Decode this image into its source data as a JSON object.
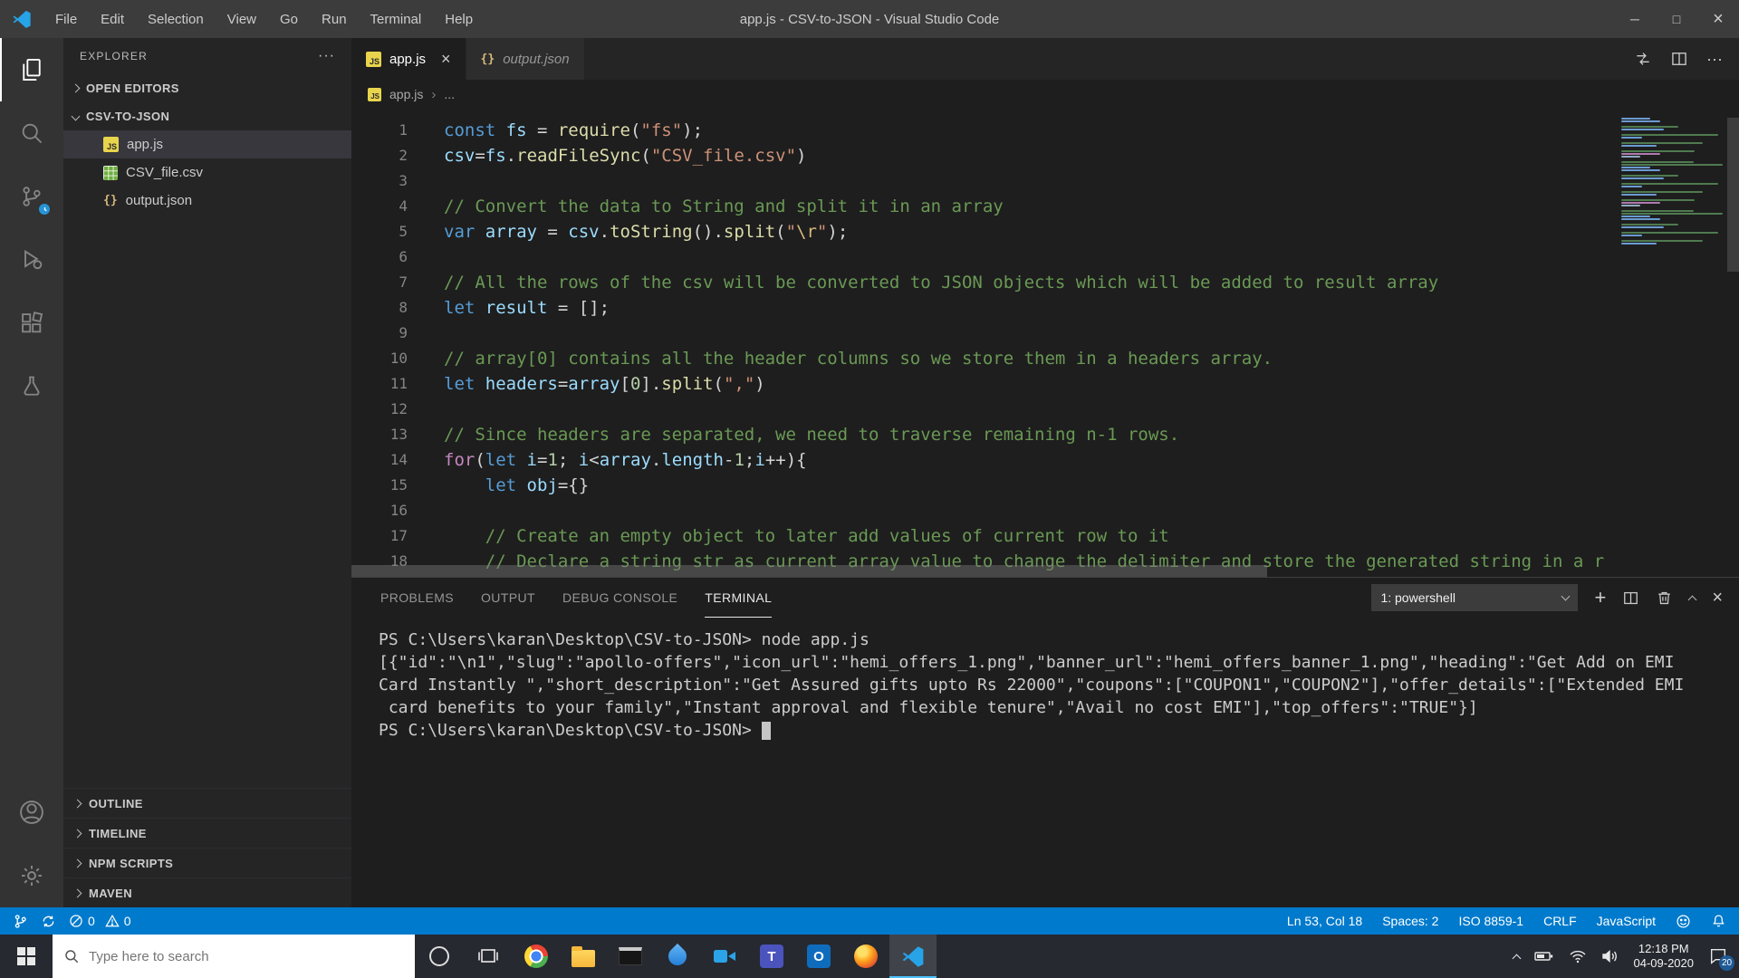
{
  "window": {
    "title": "app.js - CSV-to-JSON - Visual Studio Code",
    "menus": [
      "File",
      "Edit",
      "Selection",
      "View",
      "Go",
      "Run",
      "Terminal",
      "Help"
    ]
  },
  "icons": {
    "minimize": "─",
    "maximize": "□",
    "close": "×",
    "more_horizontal": "···",
    "breadcrumb_chevron": "›",
    "plus": "+",
    "js_glyph": "JS",
    "json_glyph": "{}",
    "teams_glyph": "T",
    "outlook_glyph": "O"
  },
  "activity_bar": {
    "items": [
      "explorer",
      "search",
      "source-control",
      "run-debug",
      "extensions",
      "test",
      "accounts",
      "settings"
    ]
  },
  "sidebar": {
    "title": "EXPLORER",
    "open_editors_label": "OPEN EDITORS",
    "folder_label": "CSV-TO-JSON",
    "files": [
      {
        "name": "app.js",
        "icon": "js",
        "selected": true
      },
      {
        "name": "CSV_file.csv",
        "icon": "csv",
        "selected": false
      },
      {
        "name": "output.json",
        "icon": "json",
        "selected": false
      }
    ],
    "bottom_sections": [
      "OUTLINE",
      "TIMELINE",
      "NPM SCRIPTS",
      "MAVEN"
    ]
  },
  "editor_tabs": [
    {
      "label": "app.js",
      "icon": "js",
      "active": true,
      "preview": false
    },
    {
      "label": "output.json",
      "icon": "json",
      "active": false,
      "preview": true
    }
  ],
  "breadcrumb": {
    "file": "app.js",
    "more": "..."
  },
  "editor": {
    "lines": [
      {
        "n": 1,
        "tokens": [
          [
            "kw",
            "const "
          ],
          [
            "var",
            "fs"
          ],
          [
            "pun",
            " = "
          ],
          [
            "fn",
            "require"
          ],
          [
            "pun",
            "("
          ],
          [
            "str",
            "\"fs\""
          ],
          [
            "pun",
            ");"
          ]
        ]
      },
      {
        "n": 2,
        "tokens": [
          [
            "var",
            "csv"
          ],
          [
            "pun",
            "="
          ],
          [
            "var",
            "fs"
          ],
          [
            "pun",
            "."
          ],
          [
            "fn",
            "readFileSync"
          ],
          [
            "pun",
            "("
          ],
          [
            "str",
            "\"CSV_file.csv\""
          ],
          [
            "pun",
            ")"
          ]
        ]
      },
      {
        "n": 3,
        "tokens": []
      },
      {
        "n": 4,
        "tokens": [
          [
            "com",
            "// Convert the data to String and split it in an array"
          ]
        ]
      },
      {
        "n": 5,
        "tokens": [
          [
            "kw",
            "var "
          ],
          [
            "var",
            "array"
          ],
          [
            "pun",
            " = "
          ],
          [
            "var",
            "csv"
          ],
          [
            "pun",
            "."
          ],
          [
            "fn",
            "toString"
          ],
          [
            "pun",
            "()."
          ],
          [
            "fn",
            "split"
          ],
          [
            "pun",
            "("
          ],
          [
            "str",
            "\""
          ],
          [
            "esc",
            "\\r"
          ],
          [
            "str",
            "\""
          ],
          [
            "pun",
            ");"
          ]
        ]
      },
      {
        "n": 6,
        "tokens": []
      },
      {
        "n": 7,
        "tokens": [
          [
            "com",
            "// All the rows of the csv will be converted to JSON objects which will be added to result array"
          ]
        ]
      },
      {
        "n": 8,
        "tokens": [
          [
            "kw",
            "let "
          ],
          [
            "var",
            "result"
          ],
          [
            "pun",
            " = [];"
          ]
        ]
      },
      {
        "n": 9,
        "tokens": []
      },
      {
        "n": 10,
        "tokens": [
          [
            "com",
            "// array[0] contains all the header columns so we store them in a headers array."
          ]
        ]
      },
      {
        "n": 11,
        "tokens": [
          [
            "kw",
            "let "
          ],
          [
            "var",
            "headers"
          ],
          [
            "pun",
            "="
          ],
          [
            "var",
            "array"
          ],
          [
            "pun",
            "["
          ],
          [
            "num",
            "0"
          ],
          [
            "pun",
            "]."
          ],
          [
            "fn",
            "split"
          ],
          [
            "pun",
            "("
          ],
          [
            "str",
            "\",\""
          ],
          [
            "pun",
            ")"
          ]
        ]
      },
      {
        "n": 12,
        "tokens": []
      },
      {
        "n": 13,
        "tokens": [
          [
            "com",
            "// Since headers are separated, we need to traverse remaining n-1 rows."
          ]
        ]
      },
      {
        "n": 14,
        "tokens": [
          [
            "ctrl",
            "for"
          ],
          [
            "pun",
            "("
          ],
          [
            "kw",
            "let "
          ],
          [
            "var",
            "i"
          ],
          [
            "pun",
            "="
          ],
          [
            "num",
            "1"
          ],
          [
            "pun",
            "; "
          ],
          [
            "var",
            "i"
          ],
          [
            "pun",
            "<"
          ],
          [
            "var",
            "array"
          ],
          [
            "pun",
            "."
          ],
          [
            "var",
            "length"
          ],
          [
            "pun",
            "-"
          ],
          [
            "num",
            "1"
          ],
          [
            "pun",
            ";"
          ],
          [
            "var",
            "i"
          ],
          [
            "pun",
            "++){"
          ]
        ]
      },
      {
        "n": 15,
        "tokens": [
          [
            "pun",
            "    "
          ],
          [
            "kw",
            "let "
          ],
          [
            "var",
            "obj"
          ],
          [
            "pun",
            "={}"
          ]
        ]
      },
      {
        "n": 16,
        "tokens": []
      },
      {
        "n": 17,
        "tokens": [
          [
            "com",
            "    // Create an empty object to later add values of current row to it"
          ]
        ]
      },
      {
        "n": 18,
        "tokens": [
          [
            "com",
            "    // Declare a string str as current array value to change the delimiter and store the generated string in a r"
          ]
        ]
      }
    ]
  },
  "panel": {
    "tabs": [
      "PROBLEMS",
      "OUTPUT",
      "DEBUG CONSOLE",
      "TERMINAL"
    ],
    "active_tab": "TERMINAL",
    "shell_selector": "1: powershell",
    "terminal_lines": [
      {
        "text": "PS C:\\Users\\karan\\Desktop\\CSV-to-JSON> node app.js",
        "cursor": false
      },
      {
        "text": "[{\"id\":\"\\n1\",\"slug\":\"apollo-offers\",\"icon_url\":\"hemi_offers_1.png\",\"banner_url\":\"hemi_offers_banner_1.png\",\"heading\":\"Get Add on EMI",
        "cursor": false
      },
      {
        "text": "Card Instantly \",\"short_description\":\"Get Assured gifts upto Rs 22000\",\"coupons\":[\"COUPON1\",\"COUPON2\"],\"offer_details\":[\"Extended EMI",
        "cursor": false
      },
      {
        "text": " card benefits to your family\",\"Instant approval and flexible tenure\",\"Avail no cost EMI\"],\"top_offers\":\"TRUE\"}]",
        "cursor": false
      },
      {
        "text": "PS C:\\Users\\karan\\Desktop\\CSV-to-JSON> ",
        "cursor": true
      }
    ]
  },
  "status_bar": {
    "errors": "0",
    "warnings": "0",
    "line_col": "Ln 53, Col 18",
    "spaces": "Spaces: 2",
    "encoding": "ISO 8859-1",
    "eol": "CRLF",
    "language": "JavaScript"
  },
  "taskbar": {
    "search_placeholder": "Type here to search",
    "time": "12:18 PM",
    "date": "04-09-2020",
    "notification_count": "20"
  }
}
